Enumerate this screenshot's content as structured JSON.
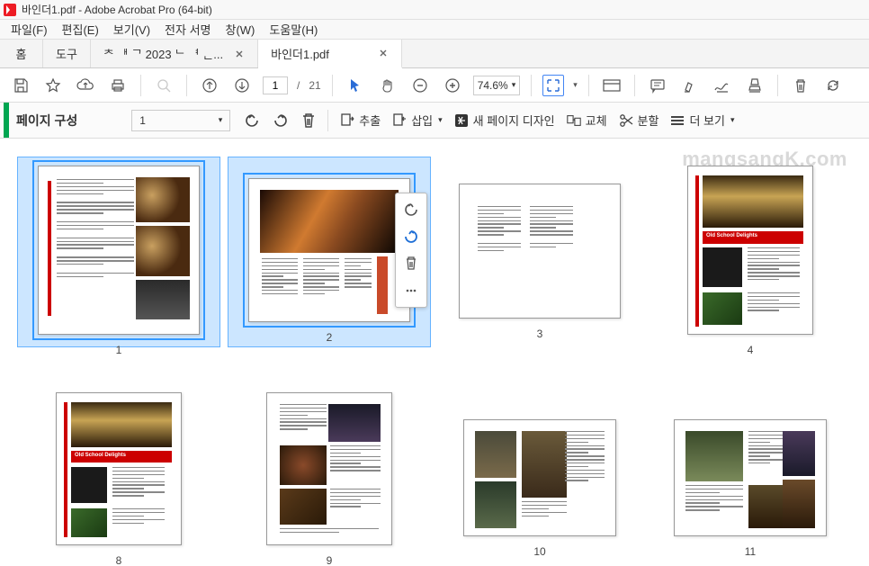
{
  "title": "바인더1.pdf - Adobe Acrobat Pro (64-bit)",
  "menu": {
    "file": "파일(F)",
    "edit": "편집(E)",
    "view": "보기(V)",
    "sign": "전자 서명",
    "window": "창(W)",
    "help": "도움말(H)"
  },
  "tabs": {
    "home": "홈",
    "tools": "도구",
    "doc1": "ᄎ ᅢ ᄀ 2023 ᄂ ᅧ ᆫ...",
    "doc2": "바인더1.pdf"
  },
  "toolbar": {
    "current_page": "1",
    "page_sep": "/",
    "total_pages": "21",
    "zoom": "74.6%"
  },
  "orgbar": {
    "title": "페이지 구성",
    "page_selector": "1",
    "extract": "추출",
    "insert": "삽입",
    "design": "새 페이지 디자인",
    "replace": "교체",
    "split": "분할",
    "more": "더 보기"
  },
  "thumbs": [
    "1",
    "2",
    "3",
    "4",
    "8",
    "9",
    "10",
    "11"
  ],
  "watermark": "mangsangK.com"
}
